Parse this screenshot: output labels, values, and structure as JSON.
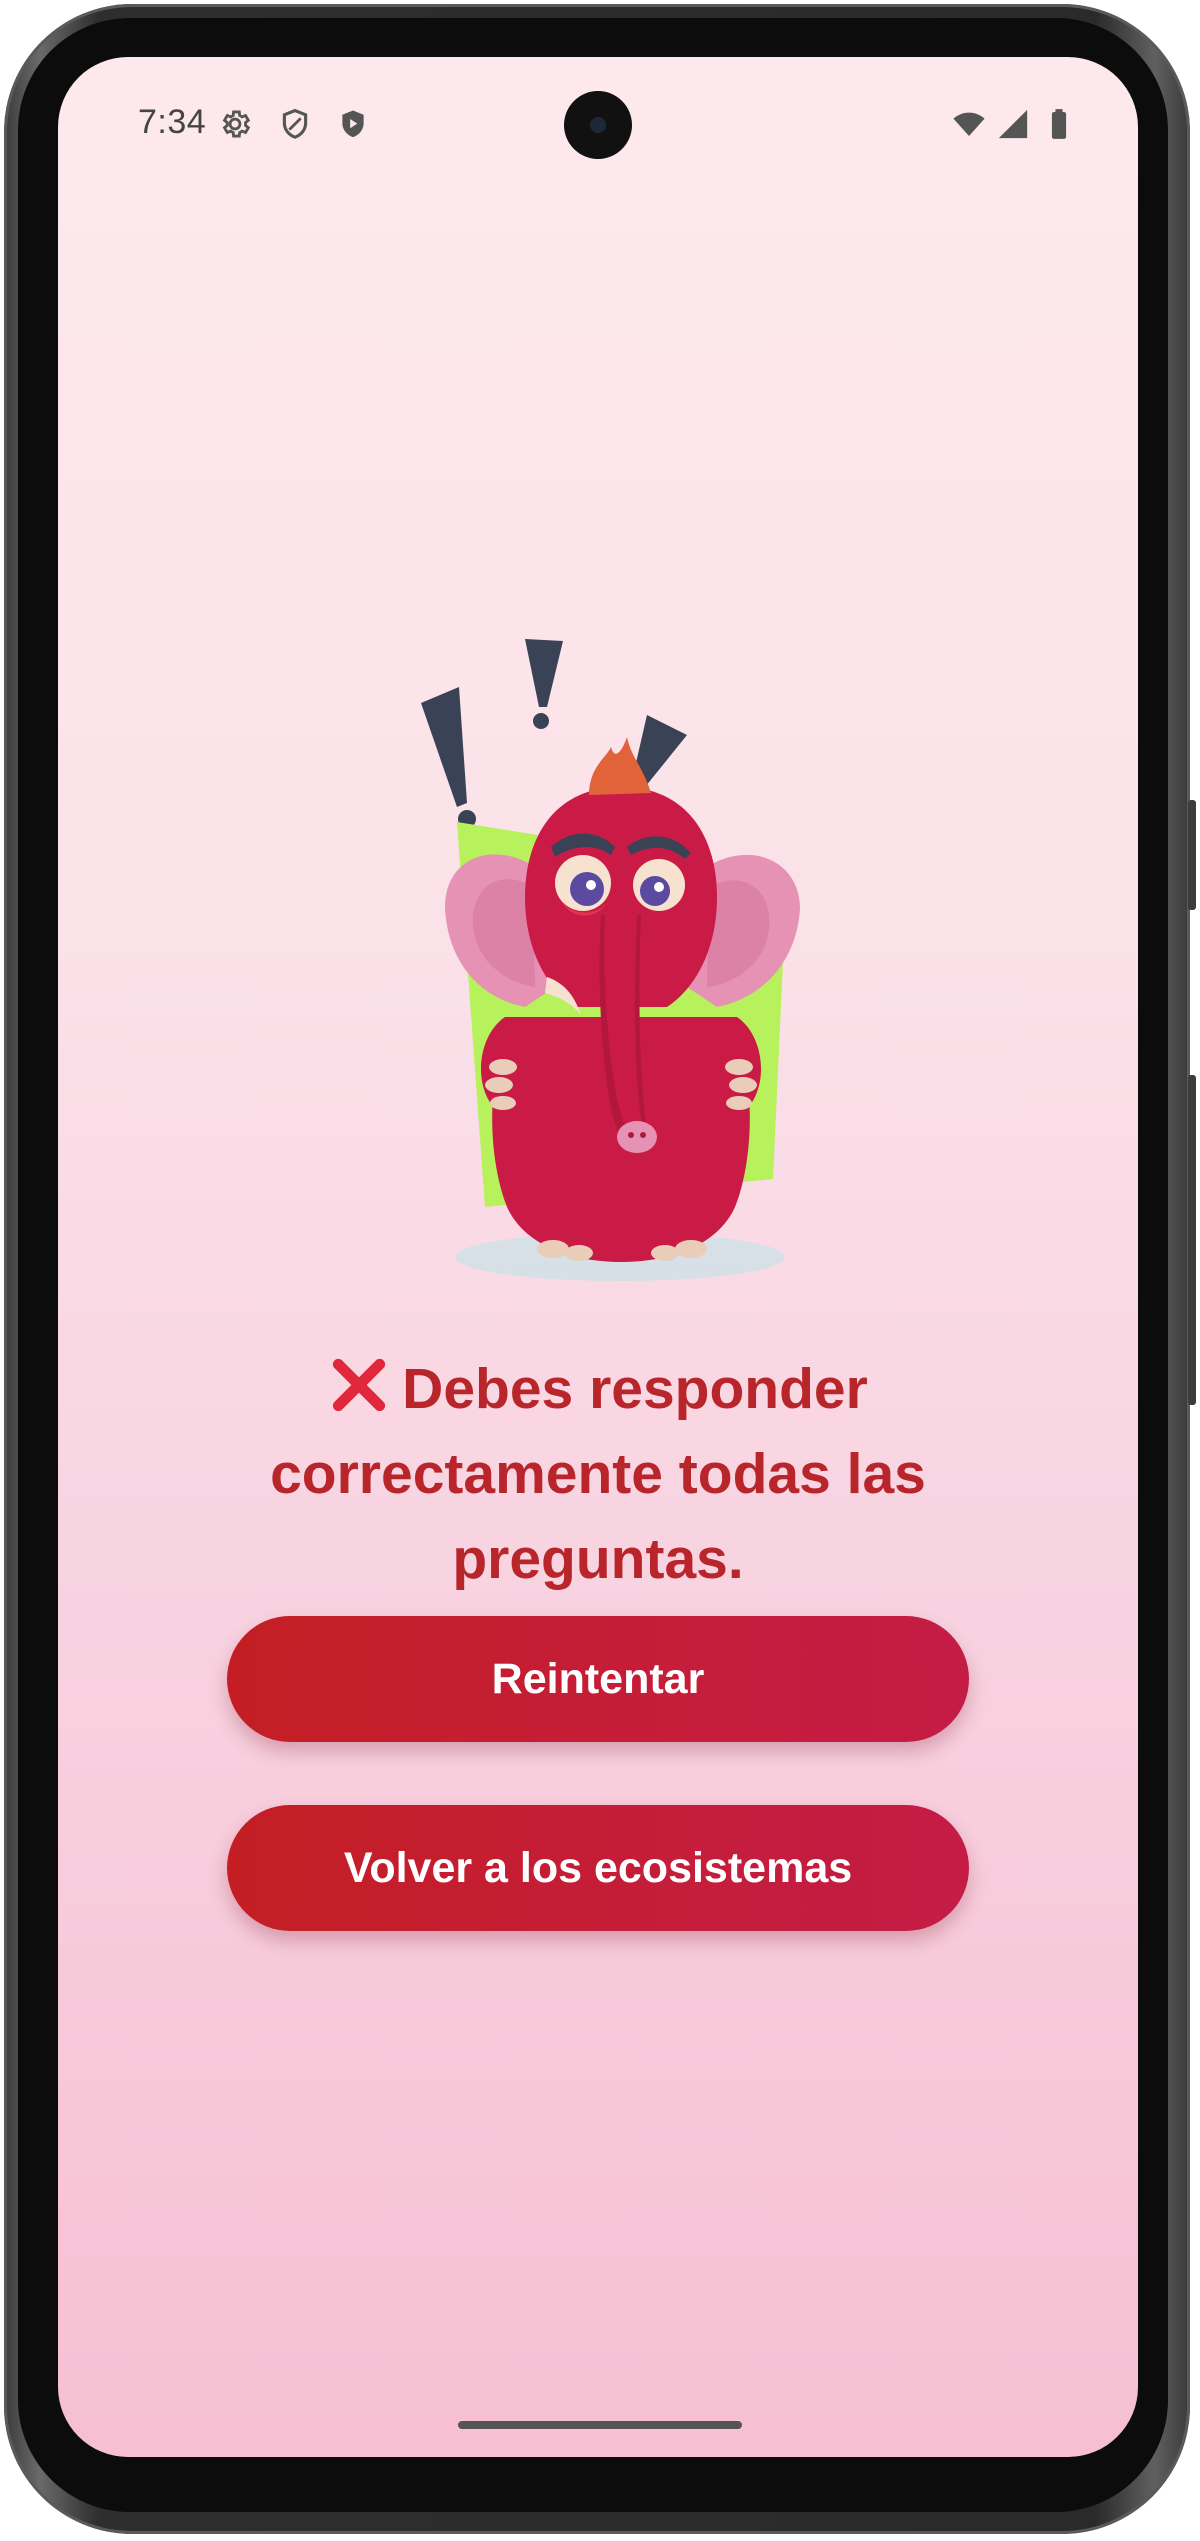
{
  "status_bar": {
    "time": "7:34",
    "left_icons": [
      "gear-icon",
      "shield-icon",
      "shield-play-icon"
    ],
    "right_icons": [
      "wifi-icon",
      "cell-signal-icon",
      "battery-icon"
    ]
  },
  "illustration": {
    "name": "confused-pink-elephant-with-exclamation-marks",
    "colors": {
      "body": "#c91b45",
      "ears": "#e692b5",
      "backdrop": "#b7f25c",
      "exclamation": "#3a4256",
      "hair": "#e0633a"
    }
  },
  "result": {
    "icon": "cross-mark-icon",
    "message": "Debes responder correctamente todas las preguntas."
  },
  "buttons": {
    "retry_label": "Reintentar",
    "back_label": "Volver a los ecosistemas"
  },
  "colors": {
    "accent": "#c41e2f",
    "message_text": "#b8252a",
    "background_top": "#fde9ec",
    "background_bottom": "#f6bfd2"
  }
}
